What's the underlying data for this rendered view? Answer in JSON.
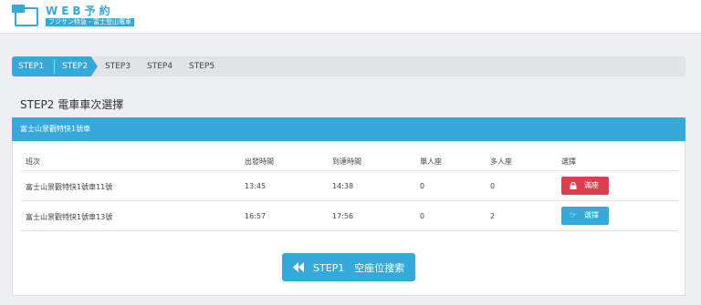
{
  "header": {
    "logo_title": "WEB予約",
    "logo_subtitle": "フジサン特急・富士登山電車"
  },
  "steps": [
    {
      "label": "STEP1",
      "active": true
    },
    {
      "label": "STEP2",
      "active": true
    },
    {
      "label": "STEP3",
      "active": false
    },
    {
      "label": "STEP4",
      "active": false
    },
    {
      "label": "STEP5",
      "active": false
    }
  ],
  "page_title": "STEP2 電車車次選擇",
  "panel": {
    "title": "富士山景觀特快1號車",
    "columns": [
      "班次",
      "出發時間",
      "到達時間",
      "單人座",
      "多人座",
      "選擇"
    ],
    "rows": [
      {
        "train": "富士山景觀特快1號車11號",
        "depart": "13:45",
        "arrive": "14:38",
        "single": "0",
        "multi": "0",
        "action": "滿座",
        "action_type": "full"
      },
      {
        "train": "富士山景觀特快1號車13號",
        "depart": "16:57",
        "arrive": "17:56",
        "single": "0",
        "multi": "2",
        "action": "選擇",
        "action_type": "select"
      }
    ]
  },
  "back_button": {
    "label": "STEP1　空座位搜索",
    "icon": "double-chevron-left-icon"
  },
  "colors": {
    "accent": "#35a9d9",
    "danger": "#dc3e4f",
    "background": "#eeeff2"
  }
}
